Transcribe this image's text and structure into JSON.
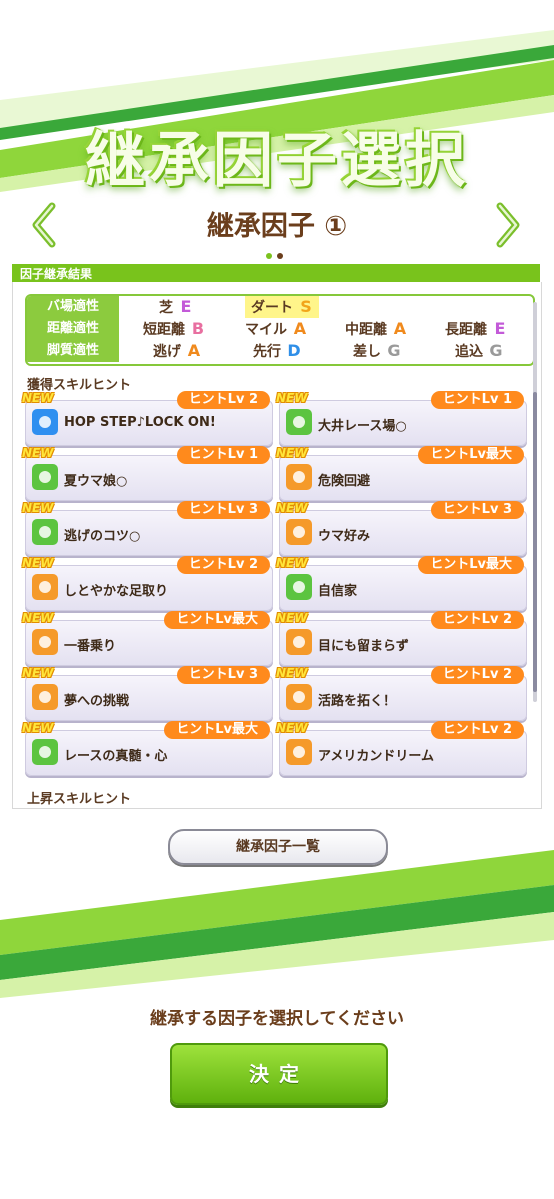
{
  "header": {
    "big_title": "継承因子選択",
    "sub_title": "継承因子 ①",
    "page_dots": 2,
    "active_dot": 0
  },
  "section": {
    "result_label": "因子継承結果"
  },
  "aptitude": {
    "rows": [
      {
        "label": "バ場適性",
        "items": [
          {
            "name": "芝",
            "grade": "E"
          },
          {
            "name": "ダート",
            "grade": "S"
          }
        ]
      },
      {
        "label": "距離適性",
        "items": [
          {
            "name": "短距離",
            "grade": "B"
          },
          {
            "name": "マイル",
            "grade": "A"
          },
          {
            "name": "中距離",
            "grade": "A"
          },
          {
            "name": "長距離",
            "grade": "E"
          }
        ]
      },
      {
        "label": "脚質適性",
        "items": [
          {
            "name": "逃げ",
            "grade": "A"
          },
          {
            "name": "先行",
            "grade": "D"
          },
          {
            "name": "差し",
            "grade": "G"
          },
          {
            "name": "追込",
            "grade": "G"
          }
        ]
      }
    ]
  },
  "skills": {
    "acquired_label": "獲得スキルヒント",
    "upgrade_label": "上昇スキルヒント",
    "new_badge": "NEW",
    "items": [
      {
        "name": "HOP STEP♪LOCK ON!",
        "hint": "ヒントLv 2",
        "icon": "sparkle-icon",
        "color": "#2f8ff0"
      },
      {
        "name": "大井レース場○",
        "hint": "ヒントLv 1",
        "icon": "heart-icon",
        "color": "#5cc440"
      },
      {
        "name": "夏ウマ娘○",
        "hint": "ヒントLv 1",
        "icon": "card-icon",
        "color": "#5cc440"
      },
      {
        "name": "危険回避",
        "hint": "ヒントLv最大",
        "icon": "dodge-icon",
        "color": "#f59a2a"
      },
      {
        "name": "逃げのコツ○",
        "hint": "ヒントLv 3",
        "icon": "book-icon",
        "color": "#5cc440"
      },
      {
        "name": "ウマ好み",
        "hint": "ヒントLv 3",
        "icon": "runner-icon",
        "color": "#f59a2a"
      },
      {
        "name": "しとやかな足取り",
        "hint": "ヒントLv 2",
        "icon": "runner-icon",
        "color": "#f59a2a"
      },
      {
        "name": "自信家",
        "hint": "ヒントLv最大",
        "icon": "card-icon",
        "color": "#5cc440"
      },
      {
        "name": "一番乗り",
        "hint": "ヒントLv最大",
        "icon": "runner-icon",
        "color": "#f59a2a"
      },
      {
        "name": "目にも留まらず",
        "hint": "ヒントLv 2",
        "icon": "runner-icon",
        "color": "#f59a2a"
      },
      {
        "name": "夢への挑戦",
        "hint": "ヒントLv 3",
        "icon": "runner-icon",
        "color": "#f59a2a"
      },
      {
        "name": "活路を拓く！",
        "hint": "ヒントLv 2",
        "icon": "runner-icon",
        "color": "#f59a2a"
      },
      {
        "name": "レースの真髄・心",
        "hint": "ヒントLv最大",
        "icon": "heart-icon",
        "color": "#5cc440"
      },
      {
        "name": "アメリカンドリーム",
        "hint": "ヒントLv 2",
        "icon": "runner-icon",
        "color": "#f59a2a"
      }
    ]
  },
  "buttons": {
    "factor_list": "継承因子一覧",
    "confirm": "決定"
  },
  "instruction": "継承する因子を選択してください",
  "colors": {
    "accent_green": "#79c31c",
    "hint_orange": "#ff8a1c",
    "grade_E": "#c35ad8",
    "grade_S": "#f2a51a",
    "grade_B": "#e86fa0",
    "grade_A": "#f08a1d",
    "grade_D": "#2f8fe8",
    "grade_G": "#9a9a9a"
  }
}
